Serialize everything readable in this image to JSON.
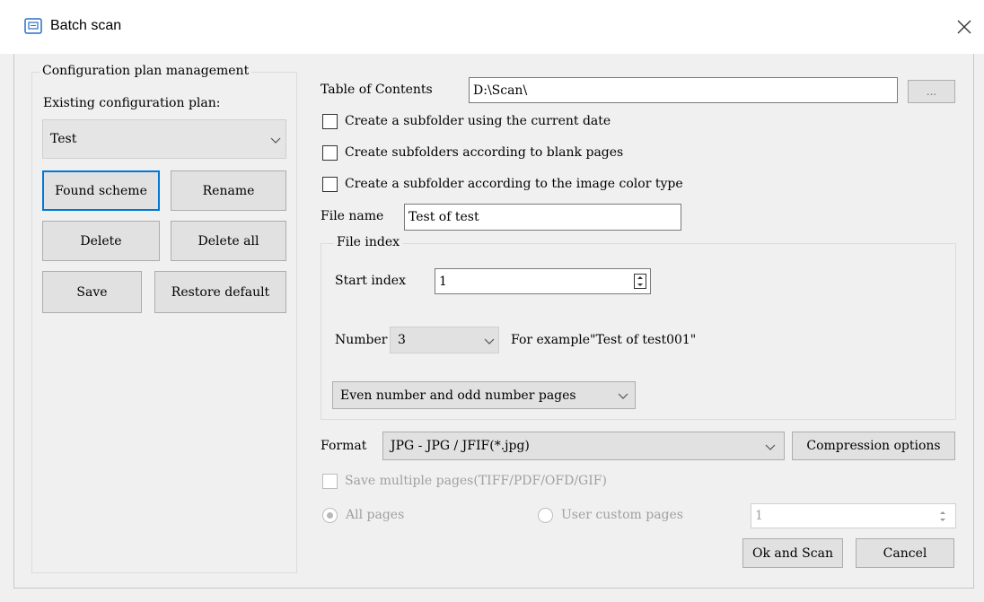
{
  "window": {
    "title": "Batch scan"
  },
  "plan": {
    "group_label": "Configuration plan management",
    "existing_label": "Existing configuration plan:",
    "selected": "Test",
    "buttons": {
      "found": "Found scheme",
      "rename": "Rename",
      "delete": "Delete",
      "delete_all": "Delete all",
      "save": "Save",
      "restore": "Restore default"
    }
  },
  "toc": {
    "label": "Table of Contents",
    "value": "D:\\Scan\\",
    "browse": "..."
  },
  "checkboxes": {
    "date": "Create a subfolder using the current date",
    "blank": "Create subfolders according to blank pages",
    "color": "Create a subfolder according to the image color type"
  },
  "file_name": {
    "label": "File name",
    "value": "Test of test"
  },
  "file_index": {
    "group_label": "File index",
    "start_label": "Start index",
    "start_value": "1",
    "number_label": "Number",
    "number_value": "3",
    "example": "For example\"Test of test001\"",
    "pages_option": "Even number and odd number pages"
  },
  "format": {
    "label": "Format",
    "value": "JPG - JPG / JFIF(*.jpg)",
    "compression": "Compression options"
  },
  "multipage": {
    "label": "Save multiple pages(TIFF/PDF/OFD/GIF)",
    "all_pages": "All pages",
    "custom_pages": "User custom pages",
    "custom_value": "1"
  },
  "actions": {
    "ok": "Ok and Scan",
    "cancel": "Cancel"
  }
}
